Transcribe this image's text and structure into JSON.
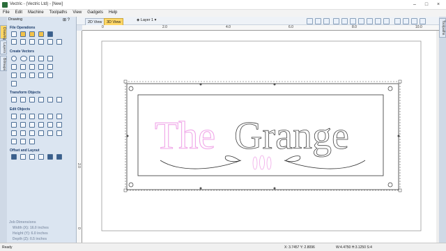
{
  "window": {
    "title": "Vectric - (Vectric Ltd) - [New]"
  },
  "menu": [
    "File",
    "Edit",
    "Machine",
    "Toolpaths",
    "View",
    "Gadgets",
    "Help"
  ],
  "view_tabs": [
    "2D View",
    "3D View"
  ],
  "layer_label": "Layer 1",
  "side_tabs": [
    "Drawing",
    "Layers",
    "Bitmaps"
  ],
  "right_tabs": [
    "Toolpaths"
  ],
  "panel": {
    "title": "Drawing",
    "sections": [
      "File Operations",
      "Create Vectors",
      "Transform Objects",
      "Edit Objects",
      "Offset and Layout"
    ]
  },
  "job": {
    "heading": "Job Dimensions",
    "width": "Width  (X): 16.0 inches",
    "height": "Height (Y): 6.0 inches",
    "depth": "Depth  (Z): 0.5 inches"
  },
  "ruler": {
    "top": [
      "0",
      "2.0",
      "4.0",
      "6.0",
      "8.0",
      "10.0"
    ],
    "left": [
      "2.0",
      "0"
    ]
  },
  "sign": {
    "word_pink": "The",
    "word_dark": "Grange"
  },
  "status": {
    "left": "Ready",
    "coords": "X: 3.7457 Y: 2.8096",
    "size": "W:4.4750   H:3.1250  S:4"
  },
  "colors": {
    "accent": "#ffd766",
    "pink": "#f0a6e8",
    "panel_bg": "#dbe5f1"
  }
}
